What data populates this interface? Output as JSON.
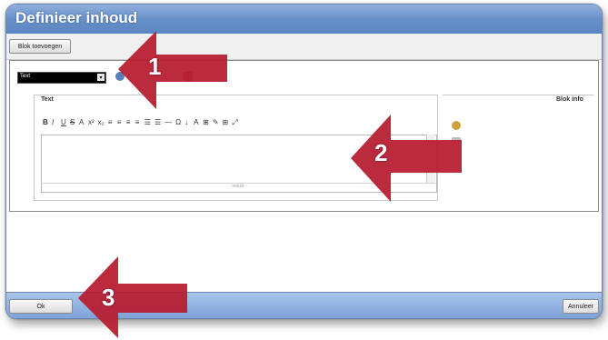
{
  "dialog": {
    "title": "Definieer inhoud",
    "add_block_button": "Blok toevoegen",
    "type_select_value": "Text",
    "text_group_label": "Text",
    "block_info_label": "Blok info",
    "toolbar_buttons": [
      "B",
      "I",
      "U",
      "S",
      "A",
      "x²",
      "x₂",
      "≡",
      "≡",
      "≡",
      "≡",
      "☰",
      "☰",
      "—",
      "Ω",
      "↓",
      "A",
      "⊞",
      "✎",
      "⊞",
      "⤢"
    ],
    "editor_status": "resize",
    "ok_button": "Ok",
    "cancel_button": "Annuleer"
  },
  "callouts": [
    "1",
    "2",
    "3"
  ],
  "colors": {
    "title_bar": "#6890c8",
    "callout_arrow": "#c0273a",
    "bottom_bar": "#7ea2d8"
  }
}
